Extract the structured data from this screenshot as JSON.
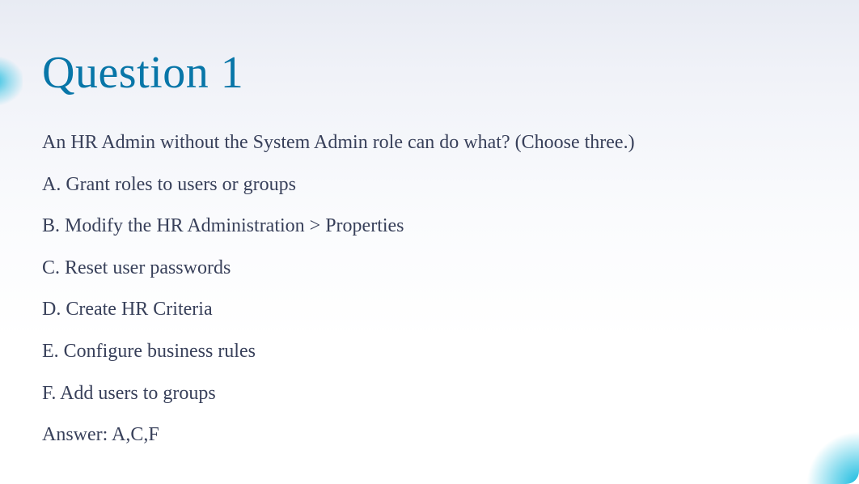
{
  "slide": {
    "title": "Question 1",
    "question": "An HR Admin without the System Admin role can do what? (Choose three.)",
    "options": [
      "A. Grant roles to users or groups",
      "B. Modify the HR Administration > Properties",
      "C. Reset user passwords",
      "D. Create HR Criteria",
      "E. Configure business rules",
      "F. Add users to groups"
    ],
    "answer": "Answer: A,C,F"
  }
}
